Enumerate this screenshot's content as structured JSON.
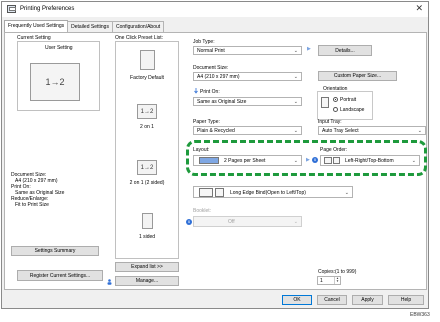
{
  "window": {
    "title": "Printing Preferences",
    "close_glyph": "✕"
  },
  "tabs": [
    {
      "label": "Frequently Used Settings",
      "active": true
    },
    {
      "label": "Detailed Settings",
      "active": false
    },
    {
      "label": "Configuration/About",
      "active": false
    }
  ],
  "current_setting": {
    "heading": "Current Setting",
    "name": "User Setting",
    "preview_text": "1→2"
  },
  "summary": {
    "lines": [
      "Document Size:",
      "A4 (210 x 297 mm)",
      "Print On:",
      "Same as Original Size",
      "Reduce/Enlarge:",
      "Fit to Print Size"
    ],
    "settings_summary_button": "Settings Summary",
    "register_button": "Register Current Settings..."
  },
  "presets": {
    "heading": "One Click Preset List:",
    "items": [
      {
        "label": "Factory Default",
        "icon": "document-icon",
        "glyph": ""
      },
      {
        "label": "2 on 1",
        "icon": "two-pages-icon",
        "glyph": "1→2"
      },
      {
        "label": "2 on 1 (2 sided)",
        "icon": "two-pages-duplex-icon",
        "glyph": "1→2"
      },
      {
        "label": "1 sided",
        "icon": "single-sided-icon",
        "glyph": ""
      }
    ],
    "expand_button": "Expand list >>",
    "manage_button": "Manage..."
  },
  "job_type": {
    "label": "Job Type:",
    "value": "Normal Print",
    "details_button": "Details..."
  },
  "document_size": {
    "label": "Document Size:",
    "value": "A4 (210 x 297 mm)",
    "custom_button": "Custom Paper Size..."
  },
  "print_on": {
    "label": "Print On:",
    "value": "Same as Original Size"
  },
  "orientation": {
    "label": "Orientation",
    "options": [
      {
        "label": "Portrait",
        "selected": true
      },
      {
        "label": "Landscape",
        "selected": false
      }
    ]
  },
  "paper_type": {
    "label": "Paper Type:",
    "value": "Plain & Recycled"
  },
  "input_tray": {
    "label": "Input Tray:",
    "value": "Auto Tray Select"
  },
  "layout": {
    "label": "Layout:",
    "value": "2 Pages per Sheet"
  },
  "page_order": {
    "label": "Page Order:",
    "value": "Left-Right/Top-Bottom"
  },
  "duplex": {
    "value": "Long Edge Bind(Open to Left/Top)"
  },
  "booklet": {
    "label": "Booklet:",
    "value": "Off"
  },
  "copies": {
    "label": "Copies:(1 to 999)",
    "value": "1"
  },
  "footer": {
    "ok": "OK",
    "cancel": "Cancel",
    "apply": "Apply",
    "help": "Help"
  },
  "caption": "EBW363",
  "colors": {
    "highlight_dash": "#1e9a3c",
    "info_blue": "#2f6fd6",
    "accent": "#0078d7"
  }
}
